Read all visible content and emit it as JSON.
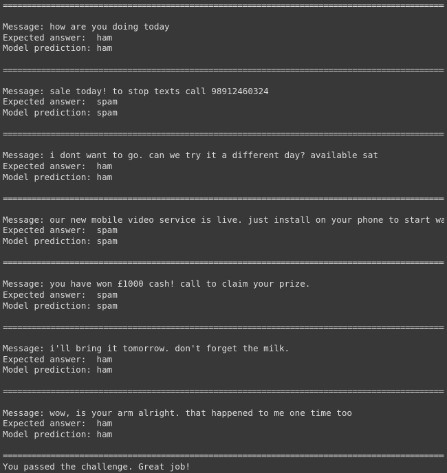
{
  "separator": "==============================================================================================================",
  "labels": {
    "message": "Message: ",
    "expected": "Expected answer:  ",
    "prediction": "Model prediction: "
  },
  "results": [
    {
      "message": "how are you doing today",
      "expected": "ham",
      "prediction": "ham"
    },
    {
      "message": "sale today! to stop texts call 98912460324",
      "expected": "spam",
      "prediction": "spam"
    },
    {
      "message": "i dont want to go. can we try it a different day? available sat",
      "expected": "ham",
      "prediction": "ham"
    },
    {
      "message": "our new mobile video service is live. just install on your phone to start watching.",
      "expected": "spam",
      "prediction": "spam"
    },
    {
      "message": "you have won £1000 cash! call to claim your prize.",
      "expected": "spam",
      "prediction": "spam"
    },
    {
      "message": "i'll bring it tomorrow. don't forget the milk.",
      "expected": "ham",
      "prediction": "ham"
    },
    {
      "message": "wow, is your arm alright. that happened to me one time too",
      "expected": "ham",
      "prediction": "ham"
    }
  ],
  "final_message": "You passed the challenge. Great job!"
}
